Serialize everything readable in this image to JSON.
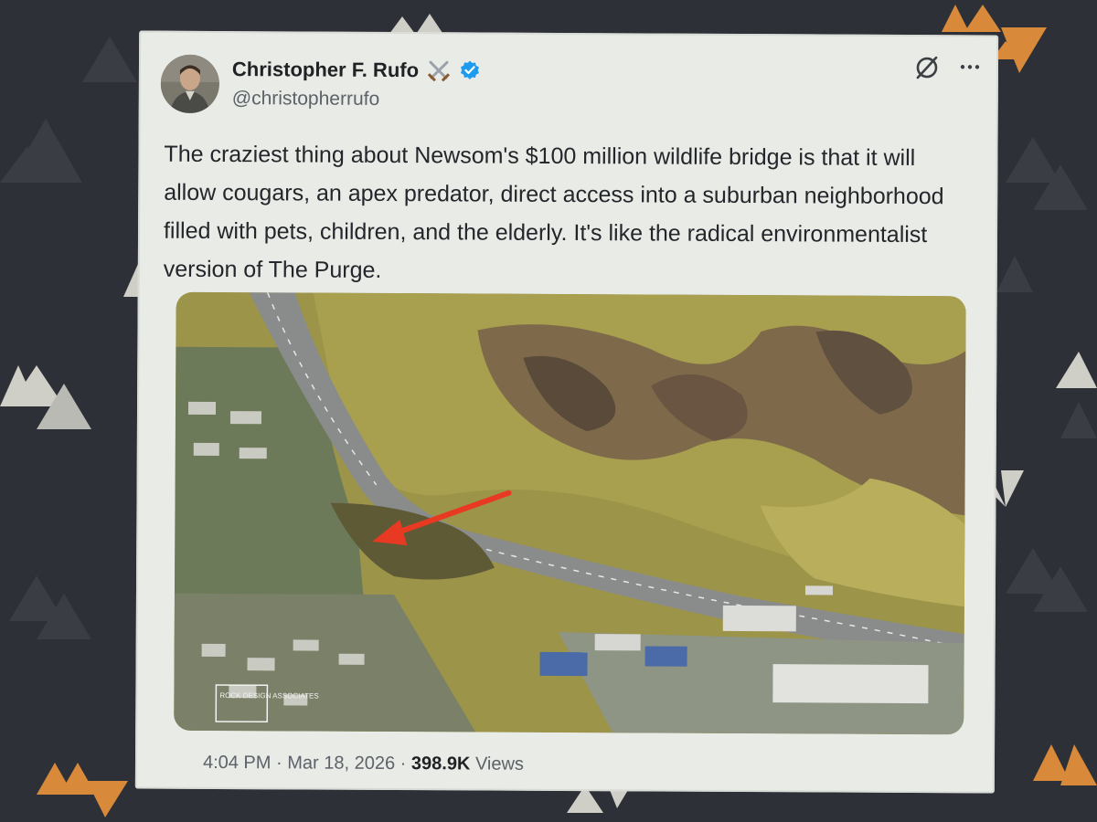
{
  "tweet": {
    "display_name": "Christopher F. Rufo",
    "handle": "@christopherrufo",
    "body": "The craziest thing about Newsom's $100 million wildlife bridge is that it will allow cougars, an apex predator, direct access into a suburban neighborhood filled with pets, children, and the elderly. It's like the radical environmentalist version of The Purge.",
    "time": "4:04 PM",
    "separator": "·",
    "date": "Mar 18, 2026",
    "views_count": "398.9K",
    "views_label": "Views",
    "media_watermark": "ROCK DESIGN ASSOCIATES"
  },
  "icons": {
    "name_emoji": "crossed-swords-icon",
    "verified": "verified-badge-icon",
    "grok": "grok-icon",
    "more": "more-options-icon"
  },
  "colors": {
    "verified_blue": "#1d9bf0",
    "arrow_red": "#e83a22",
    "card_bg": "#e9ebe7",
    "page_bg": "#2d3036",
    "pattern_orange": "#d9893a"
  }
}
